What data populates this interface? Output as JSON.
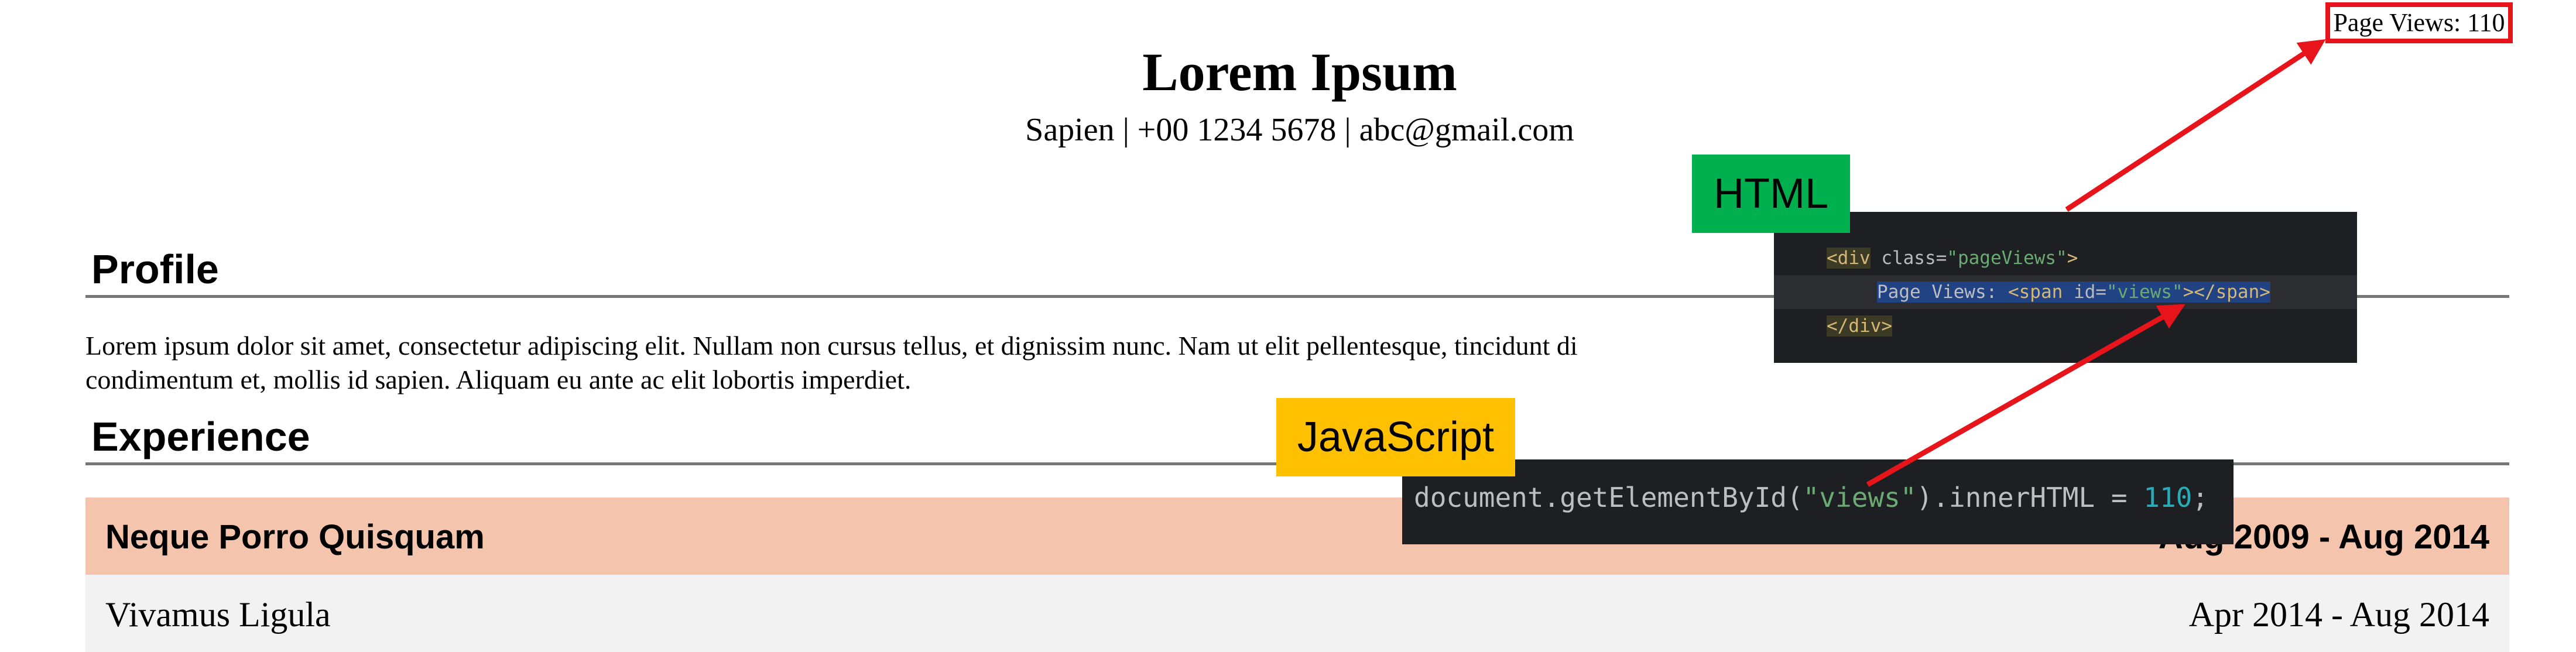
{
  "resume": {
    "name": "Lorem Ipsum",
    "contact": "Sapien | +00 1234 5678 | abc@gmail.com",
    "page_views_label": "Page Views: 110",
    "profile": {
      "heading": "Profile",
      "text_line1": "Lorem ipsum dolor sit amet, consectetur adipiscing elit. Nullam non cursus tellus, et dignissim nunc. Nam ut elit pellentesque, tincidunt di",
      "text_line2": "condimentum et, mollis id sapien. Aliquam eu ante ac elit lobortis imperdiet."
    },
    "experience": {
      "heading": "Experience",
      "jobs": [
        {
          "title": "Neque Porro Quisquam",
          "dates": "Aug 2009 - Aug 2014"
        },
        {
          "title": "Vivamus Ligula",
          "dates": "Apr 2014 - Aug 2014"
        }
      ]
    }
  },
  "annotations": {
    "html_tag": "HTML",
    "js_tag": "JavaScript",
    "html_code": {
      "line1": {
        "open": "<div",
        "attr": " class=",
        "val": "\"pageViews\"",
        "close": ">"
      },
      "line2": {
        "text": "Page Views: ",
        "open": "<span",
        "attr": " id=",
        "val": "\"views\"",
        "close": "></span>"
      },
      "line3": {
        "close": "</div>"
      }
    },
    "js_code": {
      "prefix": "document.getElementById(",
      "arg": "\"views\"",
      "middle": ").innerHTML = ",
      "value": "110",
      "end": ";"
    }
  },
  "colors": {
    "job_header_bg": "#f4c5ac",
    "annotation_border": "#e8141c",
    "html_tag_bg": "#00b04f",
    "js_tag_bg": "#ffc000",
    "code_bg": "#1e1f22"
  }
}
